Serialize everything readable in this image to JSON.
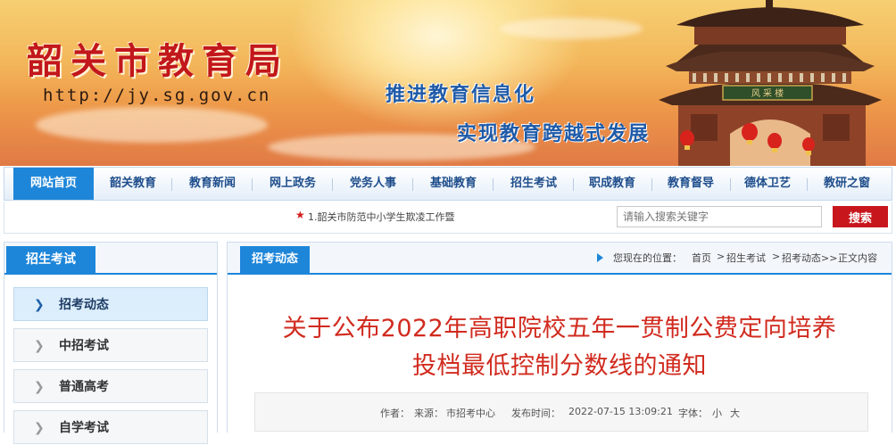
{
  "banner": {
    "title": "韶关市教育局",
    "url": "http://jy.sg.gov.cn",
    "slogan_line1": "推进教育信息化",
    "slogan_line2": "实现教育跨越式发展",
    "tower_plaque": "风采楼"
  },
  "nav": {
    "items": [
      {
        "label": "网站首页",
        "active": true
      },
      {
        "label": "韶关教育"
      },
      {
        "label": "教育新闻"
      },
      {
        "label": "网上政务"
      },
      {
        "label": "党务人事"
      },
      {
        "label": "基础教育"
      },
      {
        "label": "招生考试"
      },
      {
        "label": "职成教育"
      },
      {
        "label": "教育督导"
      },
      {
        "label": "德体卫艺"
      },
      {
        "label": "教研之窗"
      }
    ]
  },
  "ticker": {
    "icon": "star-icon",
    "text": "1.韶关市防范中小学生欺凌工作暨"
  },
  "search": {
    "placeholder": "请输入搜索关键字",
    "button_label": "搜索"
  },
  "sidebar": {
    "title": "招生考试",
    "items": [
      {
        "label": "招考动态",
        "active": true
      },
      {
        "label": "中招考试"
      },
      {
        "label": "普通高考"
      },
      {
        "label": "自学考试"
      }
    ]
  },
  "main": {
    "tab_label": "招考动态",
    "breadcrumb": {
      "prefix": "您现在的位置：",
      "items": [
        "首页",
        "招生考试",
        "招考动态>>",
        "正文内容"
      ]
    },
    "article": {
      "title_line1": "关于公布2022年高职院校五年一贯制公费定向培养",
      "title_line2": "投档最低控制分数线的通知",
      "author_label": "作者：",
      "source_label": "来源：",
      "source": "市招考中心",
      "date_label": "发布时间：",
      "date": "2022-07-15 13:09:21",
      "font_label": "字体：",
      "font_small": "小",
      "font_large": "大"
    }
  },
  "colors": {
    "primary_blue": "#1e86d9",
    "title_red": "#c2171b",
    "article_red": "#d12b1f",
    "search_red": "#c8161d"
  }
}
